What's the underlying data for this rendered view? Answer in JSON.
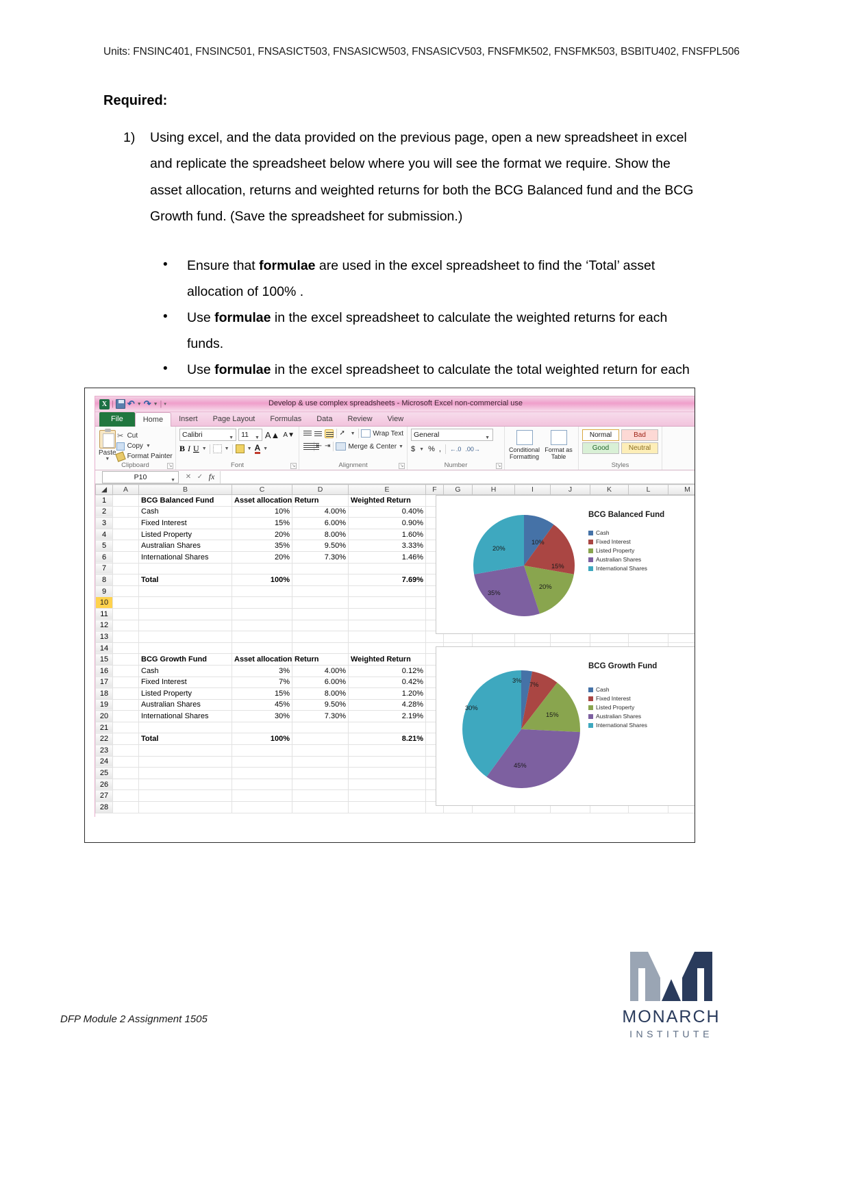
{
  "document": {
    "units_line": "Units: FNSINC401, FNSINC501, FNSASICT503, FNSASICW503, FNSASICV503, FNSFMK502, FNSFMK503, BSBITU402, FNSFPL506",
    "required_heading": "Required:",
    "numbered_items": [
      {
        "marker": "1)",
        "text": "Using excel, and the data provided on the previous page, open a new spreadsheet in excel and replicate the spreadsheet below where you will see the format we require.  Show the asset allocation, returns and weighted returns for both the BCG Balanced fund and the BCG Growth fund. (Save the spreadsheet for submission.)"
      }
    ],
    "bullets": [
      {
        "pre": "Ensure that ",
        "bold": "formulae",
        "post": " are used in the excel spreadsheet to find the ‘Total’ asset allocation of 100% ."
      },
      {
        "pre": "Use ",
        "bold": "formulae",
        "post": " in the excel spreadsheet to calculate the weighted returns for each funds."
      },
      {
        "pre": "Use ",
        "bold": "formulae",
        "post": " in the excel spreadsheet to calculate the total weighted return for each fund."
      }
    ],
    "footer": "DFP Module 2 Assignment 1505"
  },
  "logo": {
    "name": "MONARCH",
    "subtitle": "INSTITUTE"
  },
  "excel": {
    "title_bar": "Develop & use complex spreadsheets  -  Microsoft Excel non-commercial use",
    "tabs": [
      "File",
      "Home",
      "Insert",
      "Page Layout",
      "Formulas",
      "Data",
      "Review",
      "View"
    ],
    "active_tab": "Home",
    "clipboard": {
      "group_label": "Clipboard",
      "paste": "Paste",
      "cut": "Cut",
      "copy": "Copy",
      "format_painter": "Format Painter"
    },
    "font": {
      "group_label": "Font",
      "font_name": "Calibri",
      "font_size": "11",
      "bold": "B",
      "italic": "I",
      "underline": "U"
    },
    "alignment": {
      "group_label": "Alignment",
      "wrap_text": "Wrap Text",
      "merge_center": "Merge & Center"
    },
    "number": {
      "group_label": "Number",
      "format": "General",
      "currency": "$",
      "percent": "%",
      "comma": ","
    },
    "styles": {
      "group_label": "Styles",
      "conditional_formatting": "Conditional Formatting",
      "format_as_table": "Format as Table",
      "cell_styles": [
        "Normal",
        "Bad",
        "Good",
        "Neutral"
      ]
    },
    "formula_bar": {
      "name_box": "P10",
      "formula": ""
    },
    "columns": [
      "A",
      "B",
      "C",
      "D",
      "E",
      "F",
      "G",
      "H",
      "I",
      "J",
      "K",
      "L",
      "M"
    ],
    "selected_row": "10",
    "row_count": 28,
    "cells": {
      "r1": {
        "b": "BCG Balanced Fund",
        "c": "Asset allocation",
        "d": "Return",
        "e": "Weighted Return"
      },
      "r2": {
        "b": "Cash",
        "c": "10%",
        "d": "4.00%",
        "e": "0.40%"
      },
      "r3": {
        "b": "Fixed Interest",
        "c": "15%",
        "d": "6.00%",
        "e": "0.90%"
      },
      "r4": {
        "b": "Listed Property",
        "c": "20%",
        "d": "8.00%",
        "e": "1.60%"
      },
      "r5": {
        "b": "Australian Shares",
        "c": "35%",
        "d": "9.50%",
        "e": "3.33%"
      },
      "r6": {
        "b": "International Shares",
        "c": "20%",
        "d": "7.30%",
        "e": "1.46%"
      },
      "r8": {
        "b": "Total",
        "c": "100%",
        "d": "",
        "e": "7.69%"
      },
      "r15": {
        "b": "BCG Growth Fund",
        "c": "Asset allocation",
        "d": "Return",
        "e": "Weighted Return"
      },
      "r16": {
        "b": "Cash",
        "c": "3%",
        "d": "4.00%",
        "e": "0.12%"
      },
      "r17": {
        "b": "Fixed Interest",
        "c": "7%",
        "d": "6.00%",
        "e": "0.42%"
      },
      "r18": {
        "b": "Listed Property",
        "c": "15%",
        "d": "8.00%",
        "e": "1.20%"
      },
      "r19": {
        "b": "Australian Shares",
        "c": "45%",
        "d": "9.50%",
        "e": "4.28%"
      },
      "r20": {
        "b": "International Shares",
        "c": "30%",
        "d": "7.30%",
        "e": "2.19%"
      },
      "r22": {
        "b": "Total",
        "c": "100%",
        "d": "",
        "e": "8.21%"
      }
    }
  },
  "chart_data": [
    {
      "type": "pie",
      "title": "BCG Balanced Fund",
      "categories": [
        "Cash",
        "Fixed Interest",
        "Listed Property",
        "Australian Shares",
        "International Shares"
      ],
      "values": [
        10,
        15,
        20,
        35,
        20
      ],
      "data_labels": [
        "10%",
        "15%",
        "20%",
        "35%",
        "20%"
      ],
      "colors": [
        "#4572a7",
        "#aa4643",
        "#89a54e",
        "#7d60a0",
        "#3ea8bf"
      ],
      "legend_position": "right",
      "grid": false
    },
    {
      "type": "pie",
      "title": "BCG Growth Fund",
      "categories": [
        "Cash",
        "Fixed Interest",
        "Listed Property",
        "Australian Shares",
        "International Shares"
      ],
      "values": [
        3,
        7,
        15,
        45,
        30
      ],
      "data_labels": [
        "3%",
        "7%",
        "15%",
        "45%",
        "30%"
      ],
      "colors": [
        "#4572a7",
        "#aa4643",
        "#89a54e",
        "#7d60a0",
        "#3ea8bf"
      ],
      "legend_position": "right",
      "grid": false
    }
  ]
}
